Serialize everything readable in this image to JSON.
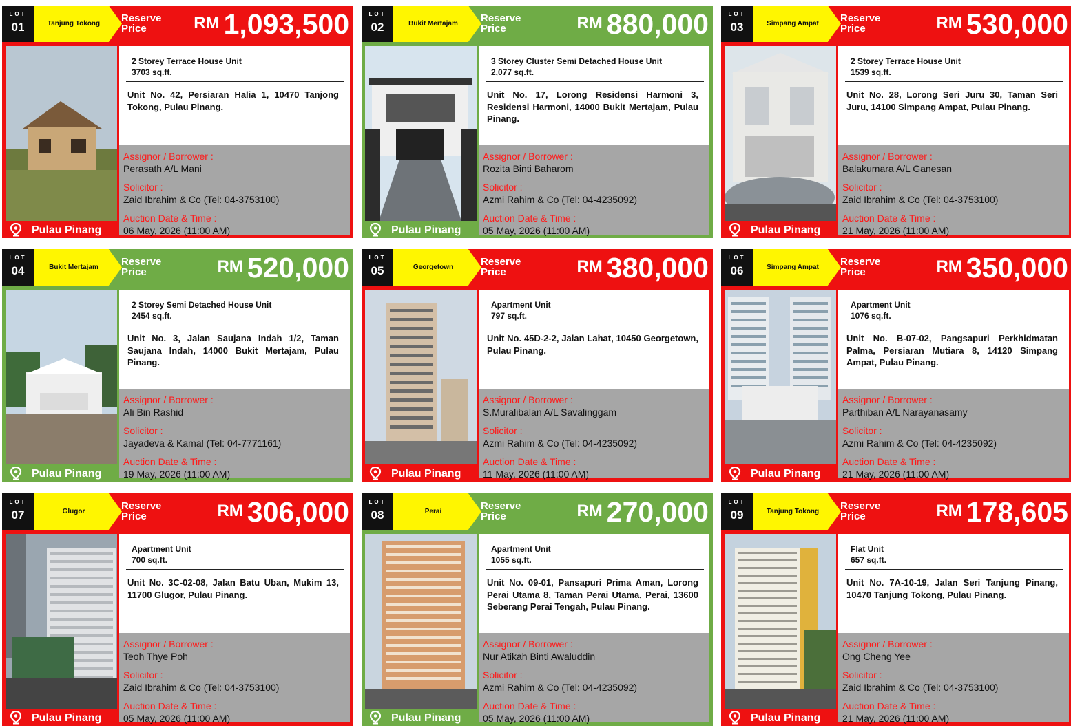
{
  "common": {
    "lot_word": "LOT",
    "reserve_label_1": "Reserve",
    "reserve_label_2": "Price",
    "currency": "RM",
    "assignor_label": "Assignor / Borrower :",
    "solicitor_label": "Solicitor :",
    "auction_label": "Auction Date & Time :",
    "pin_icon": "map-pin-icon"
  },
  "colors": {
    "red": "#ee1111",
    "green": "#6fac46",
    "tag": "#fff600",
    "label_red": "#ff1a1a"
  },
  "lots": [
    {
      "lot": "01",
      "area": "Tanjung Tokong",
      "theme": "red",
      "price": "1,093,500",
      "ptype": "2 Storey Terrace House Unit",
      "size": "3703 sq.ft.",
      "address": "Unit No. 42, Persiaran Halia 1, 10470 Tanjong Tokong, Pulau Pinang.",
      "assignor": "Perasath A/L Mani",
      "solicitor": "Zaid Ibrahim & Co (Tel: 04-3753100)",
      "auction": "06 May, 2026 (11:00 AM)",
      "location": "Pulau Pinang"
    },
    {
      "lot": "02",
      "area": "Bukit Mertajam",
      "theme": "green",
      "price": "880,000",
      "ptype": "3 Storey Cluster Semi Detached House Unit",
      "size": "2,077 sq.ft.",
      "address": "Unit No. 17, Lorong Residensi Harmoni 3, Residensi Harmoni, 14000 Bukit Mertajam, Pulau Pinang.",
      "assignor": "Rozita Binti Baharom",
      "solicitor": "Azmi Rahim & Co (Tel: 04-4235092)",
      "auction": "05 May, 2026 (11:00 AM)",
      "location": "Pulau Pinang"
    },
    {
      "lot": "03",
      "area": "Simpang Ampat",
      "theme": "red",
      "price": "530,000",
      "ptype": "2 Storey Terrace House Unit",
      "size": "1539 sq.ft.",
      "address": "Unit No. 28, Lorong Seri Juru 30, Taman Seri Juru, 14100 Simpang Ampat, Pulau Pinang.",
      "assignor": "Balakumara A/L Ganesan",
      "solicitor": "Zaid Ibrahim & Co (Tel: 04-3753100)",
      "auction": "21 May, 2026 (11:00 AM)",
      "location": "Pulau Pinang"
    },
    {
      "lot": "04",
      "area": "Bukit Mertajam",
      "theme": "green",
      "price": "520,000",
      "ptype": "2 Storey Semi Detached House Unit",
      "size": "2454 sq.ft.",
      "address": "Unit No. 3, Jalan Saujana Indah 1/2, Taman Saujana Indah, 14000 Bukit Mertajam, Pulau Pinang.",
      "assignor": "Ali Bin Rashid",
      "solicitor": "Jayadeva & Kamal (Tel: 04-7771161)",
      "auction": "19 May, 2026 (11:00 AM)",
      "location": "Pulau Pinang"
    },
    {
      "lot": "05",
      "area": "Georgetown",
      "theme": "red",
      "price": "380,000",
      "ptype": "Apartment Unit",
      "size": "797 sq.ft.",
      "address": "Unit No. 45D-2-2, Jalan Lahat, 10450 Georgetown, Pulau Pinang.",
      "assignor": "S.Muralibalan A/L Savalinggam",
      "solicitor": "Azmi Rahim & Co (Tel: 04-4235092)",
      "auction": "11 May, 2026 (11:00 AM)",
      "location": "Pulau Pinang"
    },
    {
      "lot": "06",
      "area": "Simpang Ampat",
      "theme": "red",
      "price": "350,000",
      "ptype": "Apartment Unit",
      "size": "1076 sq.ft.",
      "address": "Unit No. B-07-02, Pangsapuri Perkhidmatan Palma, Persiaran Mutiara 8, 14120 Simpang Ampat, Pulau Pinang.",
      "assignor": "Parthiban A/L Narayanasamy",
      "solicitor": "Azmi Rahim & Co (Tel: 04-4235092)",
      "auction": "21 May, 2026 (11:00 AM)",
      "location": "Pulau Pinang"
    },
    {
      "lot": "07",
      "area": "Glugor",
      "theme": "red",
      "price": "306,000",
      "ptype": "Apartment Unit",
      "size": "700 sq.ft.",
      "address": "Unit No. 3C-02-08, Jalan Batu Uban, Mukim 13, 11700 Glugor, Pulau Pinang.",
      "assignor": "Teoh Thye Poh",
      "solicitor": "Zaid Ibrahim & Co (Tel: 04-3753100)",
      "auction": "05 May, 2026 (11:00 AM)",
      "location": "Pulau Pinang"
    },
    {
      "lot": "08",
      "area": "Perai",
      "theme": "green",
      "price": "270,000",
      "ptype": "Apartment Unit",
      "size": "1055 sq.ft.",
      "address": "Unit No. 09-01, Pansapuri Prima Aman, Lorong Perai Utama 8, Taman Perai Utama, Perai, 13600 Seberang Perai Tengah, Pulau Pinang.",
      "assignor": "Nur Atikah Binti Awaluddin",
      "solicitor": "Azmi Rahim & Co (Tel: 04-4235092)",
      "auction": "05 May, 2026 (11:00 AM)",
      "location": "Pulau Pinang"
    },
    {
      "lot": "09",
      "area": "Tanjung Tokong",
      "theme": "red",
      "price": "178,605",
      "ptype": "Flat Unit",
      "size": "657 sq.ft.",
      "address": "Unit No. 7A-10-19, Jalan Seri Tanjung Pinang, 10470 Tanjung Tokong, Pulau Pinang.",
      "assignor": "Ong Cheng Yee",
      "solicitor": "Zaid Ibrahim & Co (Tel: 04-3753100)",
      "auction": "21 May, 2026 (11:00 AM)",
      "location": "Pulau Pinang"
    }
  ]
}
